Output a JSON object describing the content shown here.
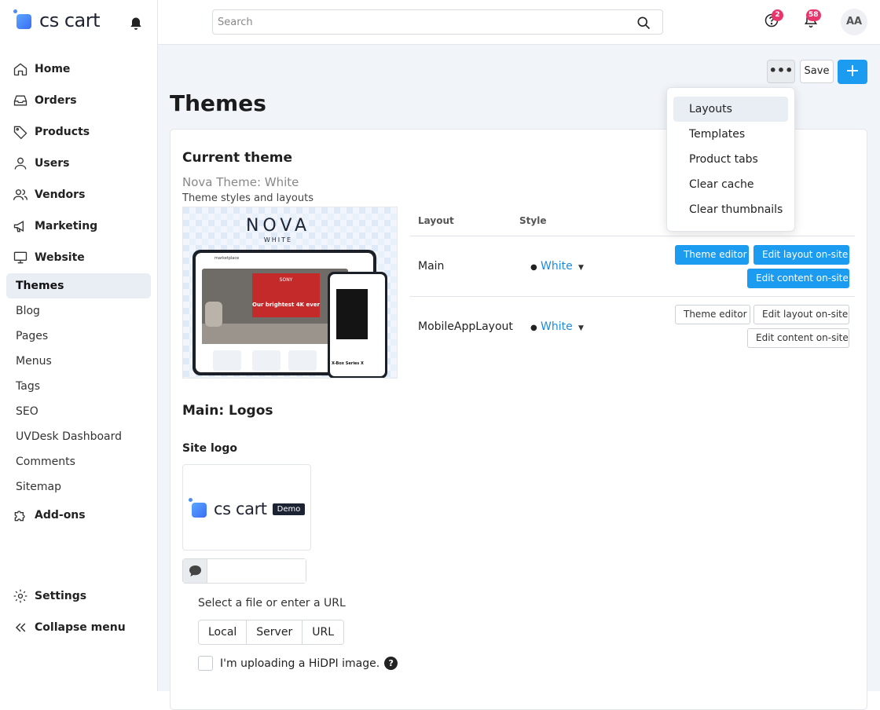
{
  "brand": {
    "logo_text": "cs cart"
  },
  "sidebar": {
    "items": [
      {
        "label": "Home",
        "icon": "home-icon"
      },
      {
        "label": "Orders",
        "icon": "inbox-icon"
      },
      {
        "label": "Products",
        "icon": "tag-icon"
      },
      {
        "label": "Users",
        "icon": "user-icon"
      },
      {
        "label": "Vendors",
        "icon": "users-icon"
      },
      {
        "label": "Marketing",
        "icon": "megaphone-icon"
      },
      {
        "label": "Website",
        "icon": "monitor-icon"
      }
    ],
    "sub_items": [
      "Themes",
      "Blog",
      "Pages",
      "Menus",
      "Tags",
      "SEO",
      "UVDesk Dashboard",
      "Comments",
      "Sitemap"
    ],
    "active_sub": "Themes",
    "addons": "Add-ons",
    "settings": "Settings",
    "collapse": "Collapse menu"
  },
  "topbar": {
    "search_placeholder": "Search",
    "help_badge": "2",
    "notif_badge": "58",
    "avatar": "AA"
  },
  "toolbar": {
    "more": "•••",
    "save": "Save",
    "add": "+"
  },
  "dropdown": {
    "items": [
      "Layouts",
      "Templates",
      "Product tabs",
      "Clear cache",
      "Clear thumbnails"
    ],
    "highlighted": "Layouts"
  },
  "page": {
    "title": "Themes"
  },
  "current_theme": {
    "heading": "Current theme",
    "name": "Nova Theme: White",
    "subtitle": "Theme styles and layouts",
    "preview": {
      "brand": "NOVA",
      "variant": "WHITE",
      "store_name": "marketplace",
      "banner_brand": "SONY",
      "banner_text": "Our brightest 4K ever",
      "product_name": "X-Box Series X"
    }
  },
  "layouts_table": {
    "headers": {
      "layout": "Layout",
      "style": "Style"
    },
    "rows": [
      {
        "layout": "Main",
        "style": "White",
        "buttons": [
          "Theme editor",
          "Edit layout on-site",
          "Edit content on-site"
        ],
        "primary": true
      },
      {
        "layout": "MobileAppLayout",
        "style": "White",
        "buttons": [
          "Theme editor",
          "Edit layout on-site",
          "Edit content on-site"
        ],
        "primary": false
      }
    ]
  },
  "logos": {
    "heading": "Main: Logos",
    "site_logo_label": "Site logo",
    "logo_text": "cs cart",
    "demo_badge": "Demo",
    "file_label": "Select a file or enter a URL",
    "sources": [
      "Local",
      "Server",
      "URL"
    ],
    "hidpi_label": "I'm uploading a HiDPI image.",
    "help_icon": "?"
  },
  "colors": {
    "accent": "#1b9cf0",
    "badge": "#e8366d",
    "link": "#1b8be0",
    "bg": "#f1f4f9"
  }
}
